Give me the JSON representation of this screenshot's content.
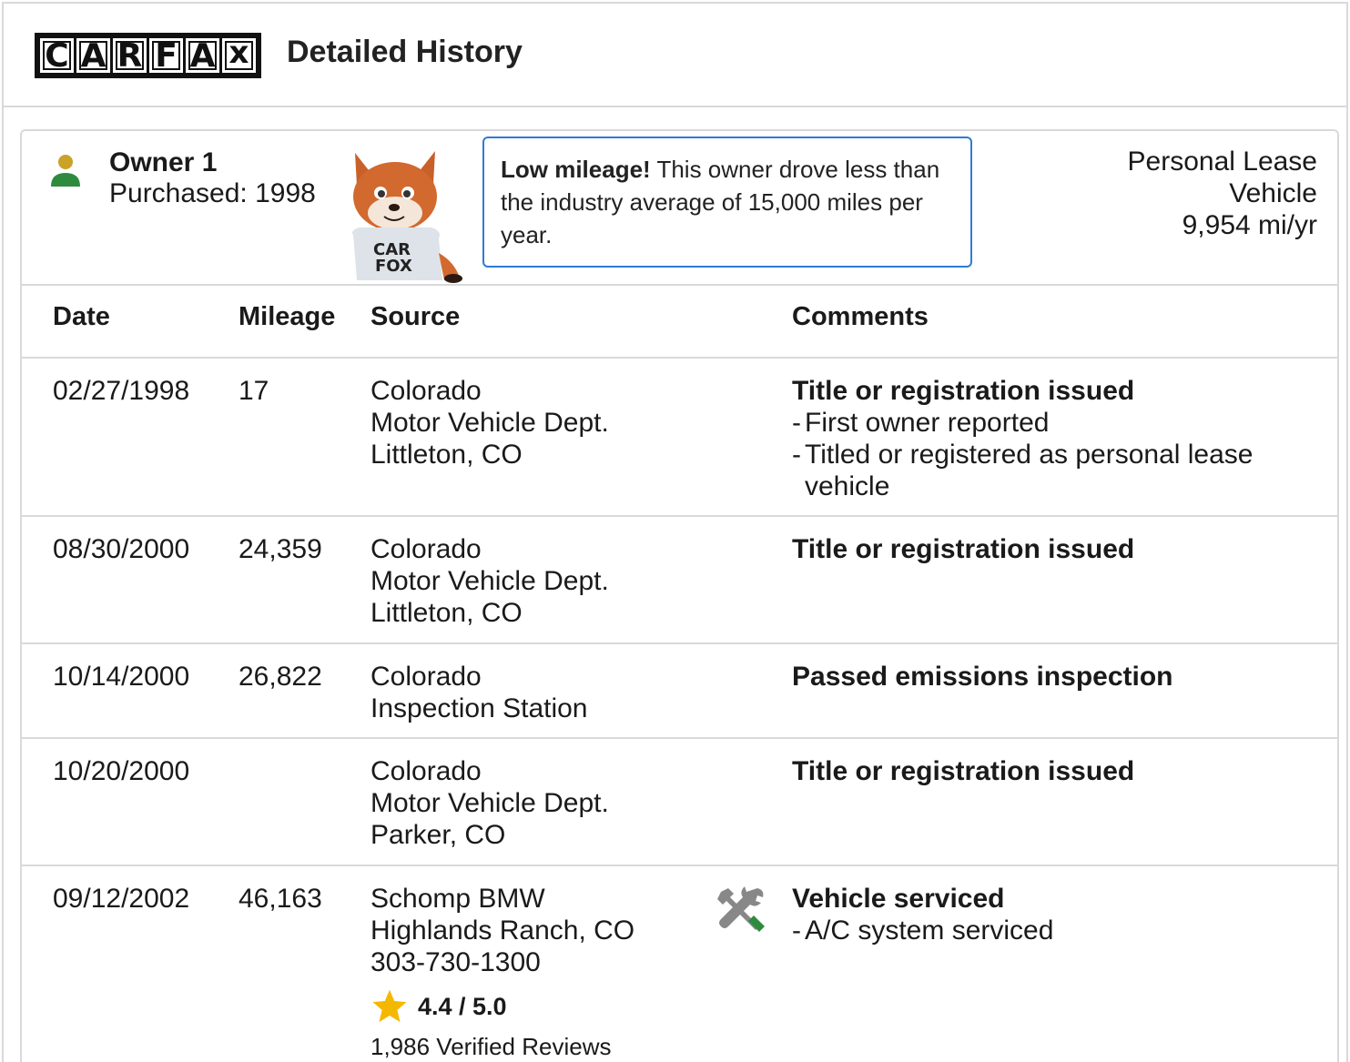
{
  "header": {
    "logo_letters": [
      "C",
      "A",
      "R",
      "F",
      "A",
      "x"
    ],
    "title": "Detailed History"
  },
  "owner": {
    "name": "Owner 1",
    "purchased": "Purchased: 1998",
    "callout_bold": "Low mileage!",
    "callout_text": " This owner drove less than the industry average of 15,000 miles per year.",
    "type_line1": "Personal Lease",
    "type_line2": "Vehicle",
    "mileage_rate": "9,954 mi/yr",
    "fox_shirt": [
      "CAR",
      "FOX"
    ]
  },
  "table": {
    "headers": {
      "date": "Date",
      "mileage": "Mileage",
      "source": "Source",
      "comments": "Comments"
    },
    "rows": [
      {
        "date": "02/27/1998",
        "mileage": "17",
        "source": [
          "Colorado",
          "Motor Vehicle Dept.",
          "Littleton, CO"
        ],
        "comment_title": "Title or registration issued",
        "comment_items": [
          "First owner reported",
          "Titled or registered as personal lease vehicle"
        ]
      },
      {
        "date": "08/30/2000",
        "mileage": "24,359",
        "source": [
          "Colorado",
          "Motor Vehicle Dept.",
          "Littleton, CO"
        ],
        "comment_title": "Title or registration issued",
        "comment_items": []
      },
      {
        "date": "10/14/2000",
        "mileage": "26,822",
        "source": [
          "Colorado",
          "Inspection Station"
        ],
        "comment_title": "Passed emissions inspection",
        "comment_items": []
      },
      {
        "date": "10/20/2000",
        "mileage": "",
        "source": [
          "Colorado",
          "Motor Vehicle Dept.",
          "Parker, CO"
        ],
        "comment_title": "Title or registration issued",
        "comment_items": []
      },
      {
        "date": "09/12/2002",
        "mileage": "46,163",
        "source": [
          "Schomp BMW",
          "Highlands Ranch, CO",
          "303-730-1300"
        ],
        "rating": "4.4 / 5.0",
        "reviews": "1,986 Verified Reviews",
        "comment_title": "Vehicle serviced",
        "comment_items": [
          "A/C system serviced"
        ]
      }
    ]
  },
  "colors": {
    "border": "#d9d9d9",
    "callout_border": "#2f7bd8",
    "owner_head": "#c9a227",
    "owner_body": "#2e8b3e",
    "star": "#f5b800",
    "tool_green": "#2e8b3e",
    "tool_gray": "#888888"
  },
  "icons": {
    "owner": "person-icon",
    "service": "wrench-screwdriver-icon",
    "rating": "star-icon"
  }
}
